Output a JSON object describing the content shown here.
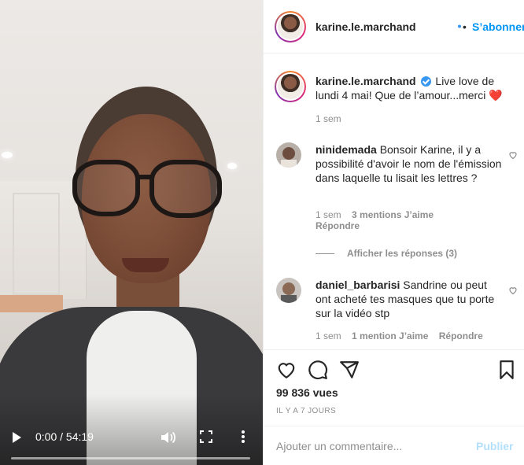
{
  "video": {
    "time": "0:00 / 54:19",
    "progress_fraction": 0.0
  },
  "header": {
    "username": "karine.le.marchand",
    "separator": "•",
    "follow_label": "S’abonner"
  },
  "caption": {
    "username": "karine.le.marchand",
    "text": "Live love de lundi 4 mai! Que de l’amour...merci ❤️",
    "time": "1 sem"
  },
  "comments": [
    {
      "username": "ninidemada",
      "text": "Bonsoir Karine, il y a possibilité d'avoir le nom de l'émission dans laquelle tu lisait les lettres ?",
      "time": "1 sem",
      "likes": "3 mentions J’aime",
      "reply": "Répondre",
      "view_replies": "Afficher les réponses (3)"
    },
    {
      "username": "daniel_barbarisi",
      "text": "Sandrine ou peut ont acheté tes masques que tu porte sur la vidéo stp",
      "time": "1 sem",
      "likes": "1 mention J’aime",
      "reply": "Répondre"
    }
  ],
  "stats": {
    "views": "99 836 vues",
    "ago": "IL Y A 7 JOURS"
  },
  "comment_box": {
    "placeholder": "Ajouter un commentaire...",
    "post_label": "Publier"
  },
  "colors": {
    "accent": "#0095f6",
    "post_disabled": "#b2dffc",
    "muted": "#8e8e8e",
    "verified": "#3897f0"
  }
}
